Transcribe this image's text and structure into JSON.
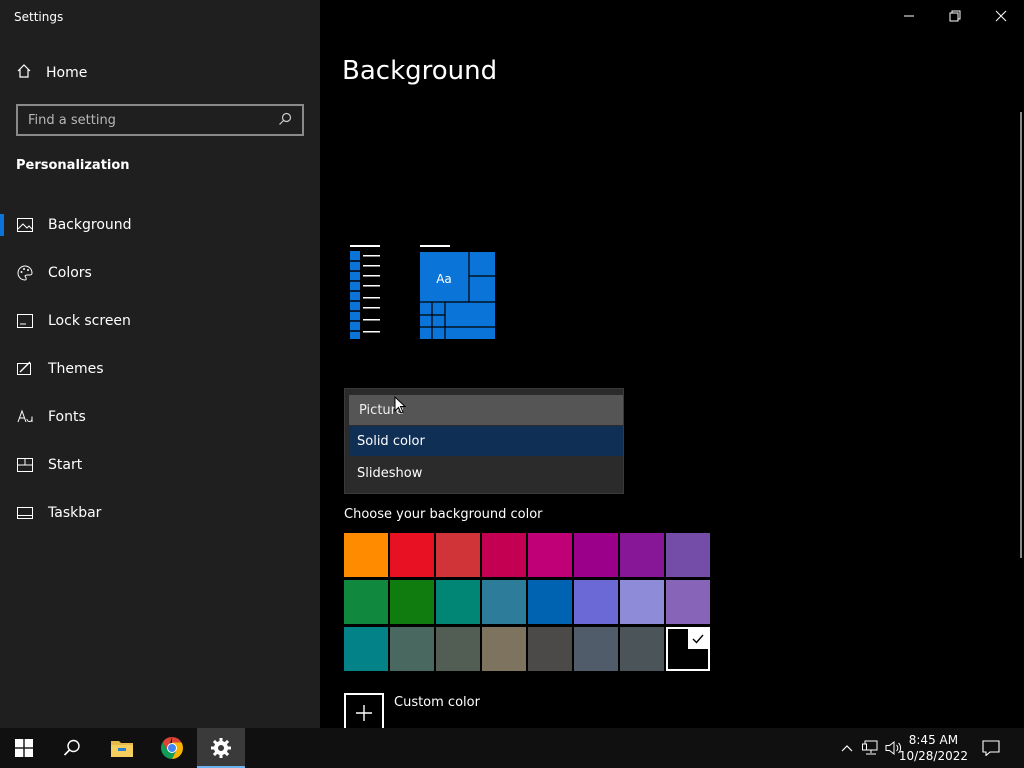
{
  "window": {
    "app_title": "Settings",
    "controls": [
      {
        "name": "minimize-button",
        "icon": "minimize-icon"
      },
      {
        "name": "restore-button",
        "icon": "restore-icon"
      },
      {
        "name": "close-button",
        "icon": "close-icon"
      }
    ]
  },
  "sidebar": {
    "home_label": "Home",
    "search_placeholder": "Find a setting",
    "section_title": "Personalization",
    "items": [
      {
        "label": "Background",
        "icon": "picture-icon",
        "active": true
      },
      {
        "label": "Colors",
        "icon": "palette-icon",
        "active": false
      },
      {
        "label": "Lock screen",
        "icon": "lock-screen-icon",
        "active": false
      },
      {
        "label": "Themes",
        "icon": "themes-icon",
        "active": false
      },
      {
        "label": "Fonts",
        "icon": "fonts-icon",
        "active": false
      },
      {
        "label": "Start",
        "icon": "start-icon",
        "active": false
      },
      {
        "label": "Taskbar",
        "icon": "taskbar-icon",
        "active": false
      }
    ]
  },
  "main": {
    "page_title": "Background",
    "preview": {
      "tile_text": "Aa",
      "accent_color": "#0a74d8"
    },
    "background_dropdown": {
      "options": [
        "Picture",
        "Solid color",
        "Slideshow"
      ],
      "hovered": "Picture",
      "selected": "Solid color"
    },
    "color_section_label": "Choose your background color",
    "colors": [
      "#ff8c00",
      "#e81123",
      "#d13438",
      "#c30052",
      "#bf0077",
      "#9a0089",
      "#881798",
      "#744da9",
      "#10893e",
      "#107c10",
      "#018574",
      "#2d7d9a",
      "#0063b1",
      "#6b69d6",
      "#8e8cd8",
      "#8764b8",
      "#038387",
      "#486860",
      "#525e54",
      "#7e735f",
      "#4c4a48",
      "#515c6b",
      "#4a5459",
      "#000000"
    ],
    "selected_color": "#000000",
    "custom_color_label": "Custom color"
  },
  "taskbar": {
    "time": "8:45 AM",
    "date": "10/28/2022",
    "pinned": [
      {
        "name": "start-button",
        "icon": "windows-logo-icon"
      },
      {
        "name": "search-button",
        "icon": "search-icon"
      },
      {
        "name": "file-explorer-button",
        "icon": "folder-icon"
      },
      {
        "name": "chrome-button",
        "icon": "chrome-icon"
      },
      {
        "name": "settings-taskbar-button",
        "icon": "gear-icon"
      }
    ],
    "tray": [
      "chevron-up-icon",
      "network-icon",
      "volume-icon",
      "notification-icon"
    ]
  }
}
